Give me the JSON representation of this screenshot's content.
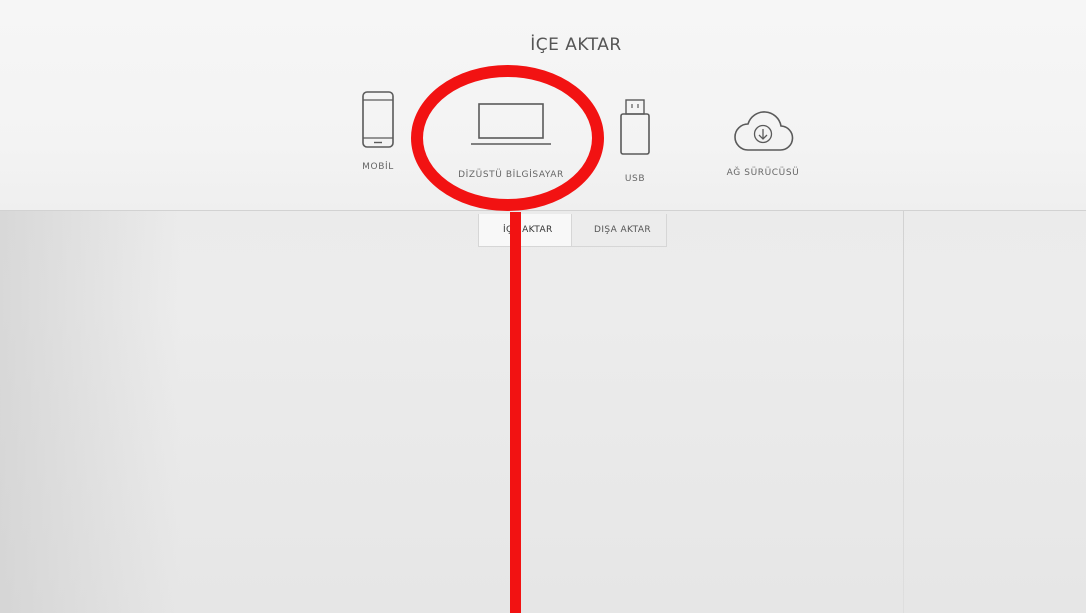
{
  "import_panel": {
    "title": "İÇE AKTAR",
    "sources": [
      {
        "label": "MOBİL",
        "icon": "smartphone-icon"
      },
      {
        "label": "DİZÜSTÜ BİLGİSAYAR",
        "icon": "laptop-icon"
      },
      {
        "label": "USB",
        "icon": "usb-drive-icon"
      },
      {
        "label": "AĞ SÜRÜCÜSÜ",
        "icon": "cloud-download-icon"
      }
    ]
  },
  "tabs": [
    {
      "label": "İÇE AKTAR",
      "active": true
    },
    {
      "label": "DIŞA AKTAR",
      "active": false
    }
  ],
  "annotation": {
    "color": "#f21212",
    "target": "DİZÜSTÜ BİLGİSAYAR"
  }
}
